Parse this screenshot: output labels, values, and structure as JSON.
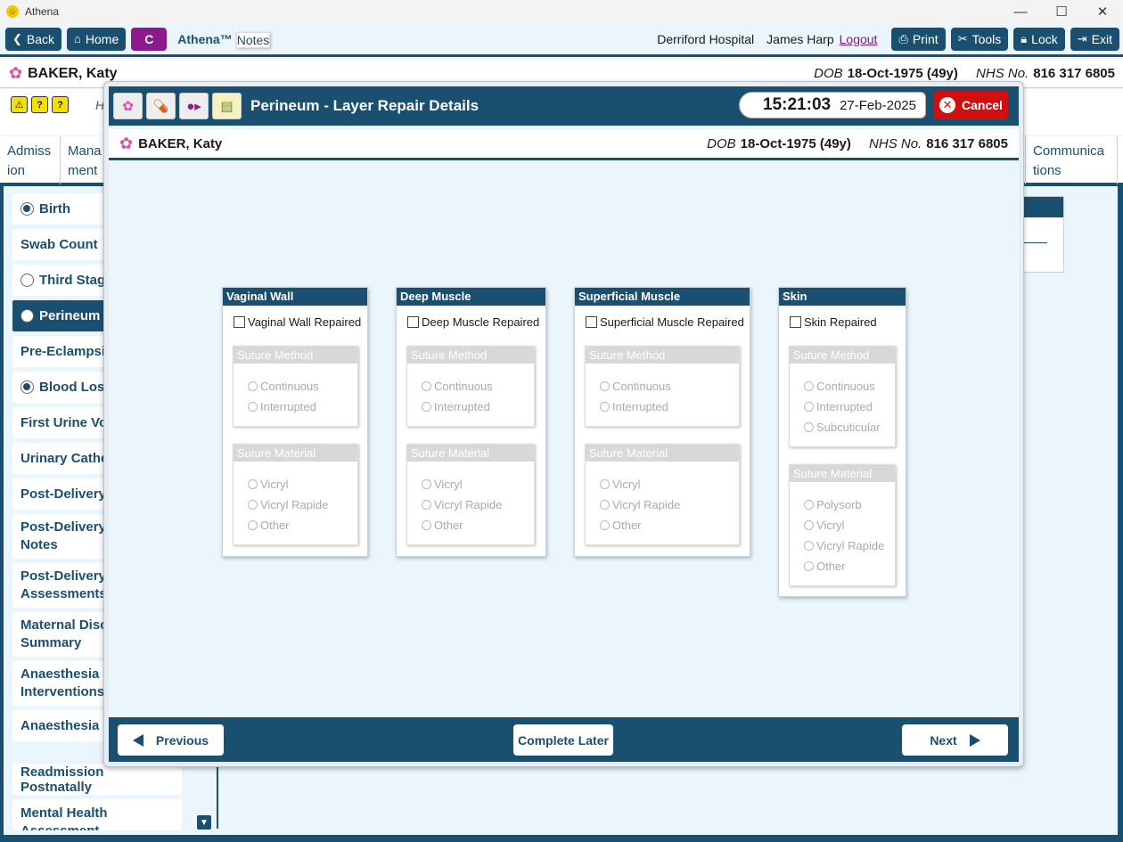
{
  "window": {
    "title": "Athena",
    "minimize": "—",
    "maximize": "☐",
    "close": "✕"
  },
  "toolbar": {
    "back": "Back",
    "home": "Home",
    "c_label": "C",
    "app_name": "Athena™",
    "app_sub": "Notes",
    "hospital": "Derriford Hospital",
    "user": "James Harp",
    "logout": "Logout",
    "print": "Print",
    "tools": "Tools",
    "lock": "Lock",
    "exit": "Exit"
  },
  "patient": {
    "name": "BAKER, Katy",
    "dob_label": "DOB",
    "dob": "18-Oct-1975 (49y)",
    "nhs_label": "NHS No.",
    "nhs": "816 317 6805"
  },
  "background": {
    "h_text": "H",
    "tabs": [
      "Admiss ion",
      "Mana ment",
      "Communica tions"
    ],
    "nav": [
      {
        "label": "Birth",
        "radio": "filled"
      },
      {
        "label": "Swab Count",
        "radio": "none"
      },
      {
        "label": "Third Stage",
        "radio": "empty"
      },
      {
        "label": "Perineum",
        "radio": "empty",
        "active": true
      },
      {
        "label": "Pre-Eclampsia",
        "radio": "none"
      },
      {
        "label": "Blood Loss",
        "radio": "filled"
      },
      {
        "label": "First Urine Voi",
        "radio": "none"
      },
      {
        "label": "Urinary Cathe",
        "radio": "none"
      },
      {
        "label": "Post-Delivery",
        "radio": "none"
      },
      {
        "label": "Post-Delivery Notes",
        "radio": "none"
      },
      {
        "label": "Post-Delivery Assessments",
        "radio": "none"
      },
      {
        "label": "Maternal Disc Summary",
        "radio": "none"
      },
      {
        "label": "Anaesthesia Interventions",
        "radio": "none"
      },
      {
        "label": "Anaesthesia F",
        "radio": "none"
      },
      {
        "label": "Readmission Postnatally",
        "radio": "none"
      },
      {
        "label": "Mental Health Assessment",
        "radio": "none"
      }
    ]
  },
  "modal": {
    "title": "Perineum - Layer Repair Details",
    "time": "15:21:03",
    "date": "27-Feb-2025",
    "cancel": "Cancel",
    "panels": [
      {
        "title": "Vaginal Wall",
        "checkbox": "Vaginal Wall Repaired",
        "method_title": "Suture Method",
        "methods": [
          "Continuous",
          "Interrupted"
        ],
        "material_title": "Suture Material",
        "materials": [
          "Vicryl",
          "Vicryl Rapide",
          "Other"
        ]
      },
      {
        "title": "Deep Muscle",
        "checkbox": "Deep Muscle Repaired",
        "method_title": "Suture Method",
        "methods": [
          "Continuous",
          "Interrupted"
        ],
        "material_title": "Suture Material",
        "materials": [
          "Vicryl",
          "Vicryl Rapide",
          "Other"
        ]
      },
      {
        "title": "Superficial Muscle",
        "checkbox": "Superficial Muscle Repaired",
        "method_title": "Suture Method",
        "methods": [
          "Continuous",
          "Interrupted"
        ],
        "material_title": "Suture Material",
        "materials": [
          "Vicryl",
          "Vicryl Rapide",
          "Other"
        ]
      },
      {
        "title": "Skin",
        "checkbox": "Skin Repaired",
        "method_title": "Suture Method",
        "methods": [
          "Continuous",
          "Interrupted",
          "Subcuticular"
        ],
        "material_title": "Suture Material",
        "materials": [
          "Polysorb",
          "Vicryl",
          "Vicryl Rapide",
          "Other"
        ]
      }
    ],
    "footer": {
      "previous": "Previous",
      "complete_later": "Complete Later",
      "next": "Next"
    }
  },
  "colors": {
    "primary": "#1a4f70",
    "accent_purple": "#8c1a8c",
    "cancel_red": "#d01010",
    "background": "#eaf5fc"
  }
}
